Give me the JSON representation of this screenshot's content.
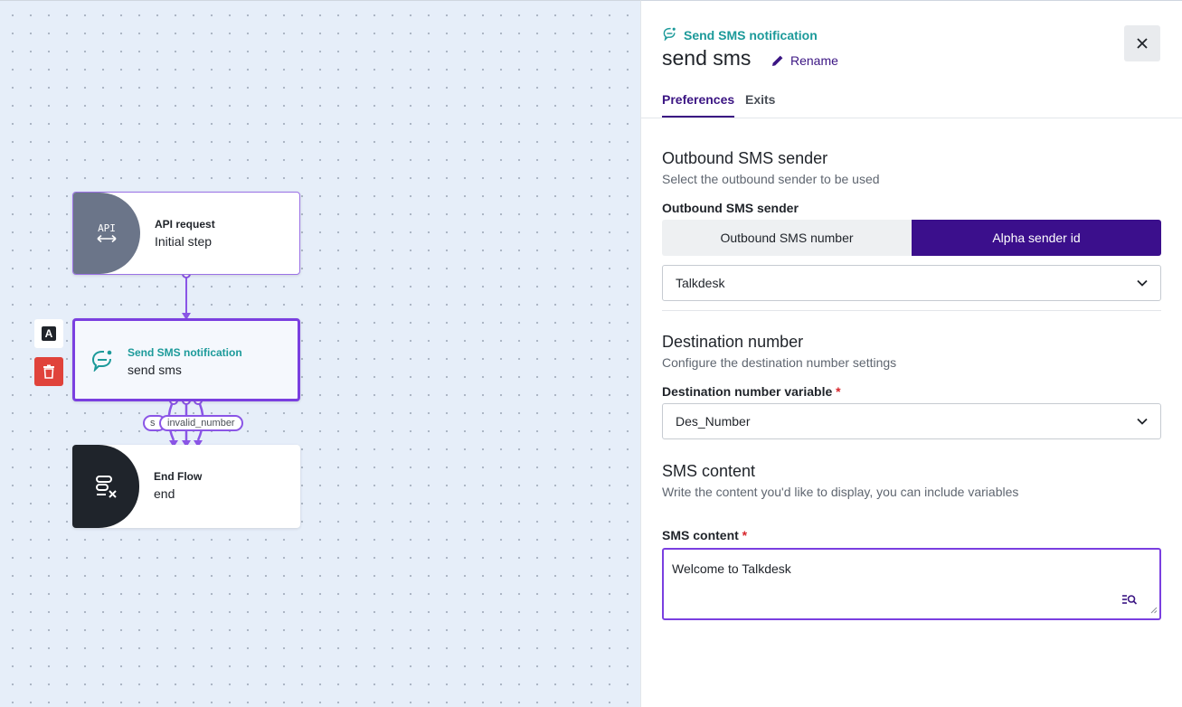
{
  "canvas": {
    "nodes": {
      "api": {
        "icon_text": "API",
        "kind": "API request",
        "name": "Initial step"
      },
      "sms": {
        "kind": "Send SMS notification",
        "name": "send sms"
      },
      "end": {
        "kind": "End Flow",
        "name": "end"
      }
    },
    "node_actions": {
      "label_button": "A"
    },
    "exits": {
      "stub_label": "s",
      "label": "invalid_number"
    }
  },
  "panel": {
    "kind": "Send SMS notification",
    "title": "send sms",
    "rename_label": "Rename",
    "tabs": [
      {
        "label": "Preferences",
        "active": true
      },
      {
        "label": "Exits",
        "active": false
      }
    ],
    "outbound": {
      "title": "Outbound SMS sender",
      "description": "Select the outbound sender to be used",
      "field_label": "Outbound SMS sender",
      "options": [
        "Outbound SMS number",
        "Alpha sender id"
      ],
      "selected_option": "Alpha sender id",
      "sender_value": "Talkdesk"
    },
    "destination": {
      "title": "Destination number",
      "description": "Configure the destination number settings",
      "field_label": "Destination number variable",
      "required_mark": "*",
      "value": "Des_Number"
    },
    "content": {
      "title": "SMS content",
      "description": "Write the content you'd like to display, you can include variables",
      "field_label": "SMS content",
      "required_mark": "*",
      "value": "Welcome to Talkdesk"
    }
  },
  "colors": {
    "accent": "#3b0f8c",
    "teal": "#1c9a9a",
    "connector": "#8a55e6",
    "danger": "#e0433b"
  }
}
